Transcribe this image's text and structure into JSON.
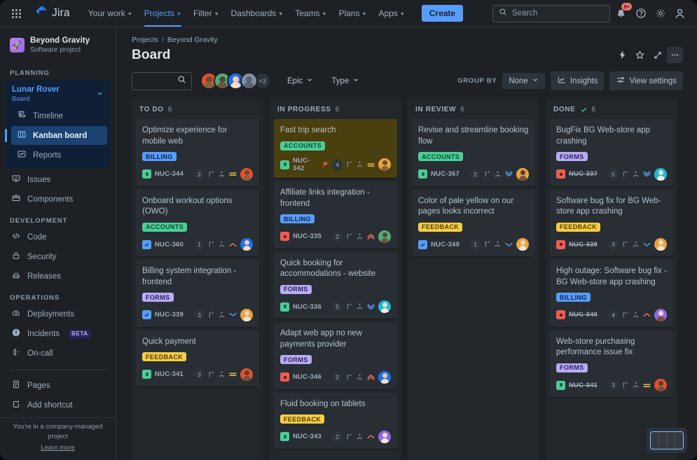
{
  "topnav": {
    "apps_icon": "apps-grid-icon",
    "brand": "Jira",
    "items": [
      {
        "label": "Your work",
        "has_caret": true,
        "active": false
      },
      {
        "label": "Projects",
        "has_caret": true,
        "active": true
      },
      {
        "label": "Filter",
        "has_caret": true,
        "active": false
      },
      {
        "label": "Dashboards",
        "has_caret": true,
        "active": false
      },
      {
        "label": "Teams",
        "has_caret": true,
        "active": false
      },
      {
        "label": "Plans",
        "has_caret": true,
        "active": false
      },
      {
        "label": "Apps",
        "has_caret": true,
        "active": false
      }
    ],
    "create_label": "Create",
    "search_placeholder": "Search",
    "notifications_badge": "9+",
    "icons": [
      "notification-bell-icon",
      "help-icon",
      "settings-gear-icon",
      "profile-avatar-icon"
    ],
    "accent": "#579dff"
  },
  "sidebar": {
    "project_name": "Beyond Gravity",
    "project_type": "Software project",
    "project_icon": "rocket-icon",
    "sections": [
      {
        "label": "PLANNING",
        "board_group": {
          "name": "Lunar Rover",
          "sub": "Board",
          "items": [
            {
              "label": "Timeline",
              "icon": "timeline-icon",
              "selected": false
            },
            {
              "label": "Kanban board",
              "icon": "board-columns-icon",
              "selected": true
            },
            {
              "label": "Reports",
              "icon": "reports-chart-icon",
              "selected": false
            }
          ]
        },
        "items": [
          {
            "label": "Issues",
            "icon": "issues-icon",
            "selected": false
          },
          {
            "label": "Components",
            "icon": "components-icon",
            "selected": false
          }
        ]
      },
      {
        "label": "DEVELOPMENT",
        "items": [
          {
            "label": "Code",
            "icon": "code-icon",
            "selected": false
          },
          {
            "label": "Security",
            "icon": "lock-icon",
            "selected": false
          },
          {
            "label": "Releases",
            "icon": "releases-ship-icon",
            "selected": false
          }
        ]
      },
      {
        "label": "OPERATIONS",
        "items": [
          {
            "label": "Deployments",
            "icon": "deployments-cloud-icon",
            "selected": false
          },
          {
            "label": "Incidents",
            "icon": "incident-alert-icon",
            "selected": false,
            "pill": "BETA"
          },
          {
            "label": "On-call",
            "icon": "on-call-phone-icon",
            "selected": false
          }
        ]
      },
      {
        "label": "",
        "items": [
          {
            "label": "Pages",
            "icon": "pages-document-icon",
            "selected": false
          },
          {
            "label": "Add shortcut",
            "icon": "add-shortcut-icon",
            "selected": false
          }
        ]
      }
    ],
    "footer_note": "You're in a company-managed project",
    "footer_link": "Learn more"
  },
  "main": {
    "breadcrumb": [
      "Projects",
      "Beyond Gravity"
    ],
    "breadcrumb_sep": "/",
    "title": "Board",
    "title_icons": [
      "lightning-automation-icon",
      "star-favorite-icon",
      "expand-fullscreen-icon",
      "more-actions-icon"
    ],
    "toolbar": {
      "search_placeholder": "",
      "search_icon": "search-icon",
      "avatars": [
        {
          "ring": "#e2502a",
          "head": "#6b4a33",
          "body": "#8a5f41"
        },
        {
          "ring": "#4bb07a",
          "head": "#5c4733",
          "body": "#6f573e"
        },
        {
          "ring": "#1e72e8",
          "head": "#f0cbae",
          "body": "#f6dcc6"
        },
        {
          "ring": "#8590a2",
          "head": "#b0b8c4",
          "body": "#b0b8c4"
        }
      ],
      "avatar_more": "+3",
      "epic_label": "Epic",
      "type_label": "Type",
      "group_by_label": "GROUP BY",
      "group_by_value": "None",
      "insights_label": "Insights",
      "insights_icon": "insights-chart-icon",
      "view_settings_label": "View settings",
      "view_settings_icon": "sliders-icon"
    },
    "minimap": {
      "segments": 4,
      "focus_color": "#85b8ff"
    }
  },
  "epic_colors": {
    "BILLING": {
      "bg": "#579dff",
      "fg": "#10243e"
    },
    "ACCOUNTS": {
      "bg": "#4bce97",
      "fg": "#164b35"
    },
    "FORMS": {
      "bg": "#b8acf6",
      "fg": "#2b2459"
    },
    "FEEDBACK": {
      "bg": "#f5cd47",
      "fg": "#533f04"
    }
  },
  "type_colors": {
    "story": {
      "bg": "#4bce97",
      "glyph": "bookmark"
    },
    "task": {
      "bg": "#579dff",
      "glyph": "check"
    },
    "bug": {
      "bg": "#f15b50",
      "glyph": "circle"
    }
  },
  "priority_colors": {
    "highest": "#f87168",
    "high": "#f87168",
    "medium": "#f5cd47",
    "low": "#579dff",
    "lowest": "#579dff"
  },
  "columns": [
    {
      "name": "TO DO",
      "count": "6",
      "done_check": false,
      "cards": [
        {
          "title": "Optimize experience for mobile web",
          "epic": "BILLING",
          "type": "story",
          "key": "NUC-344",
          "key_struck": false,
          "points": "2",
          "priority": "medium",
          "flagged": false,
          "highlight": false,
          "avatar": {
            "ring": "#e2502a",
            "head": "#6b4a33",
            "body": "#8a5f41"
          }
        },
        {
          "title": "Onboard workout options (OWO)",
          "epic": "ACCOUNTS",
          "type": "task",
          "key": "NUC-360",
          "key_struck": false,
          "points": "1",
          "priority": "high",
          "flagged": false,
          "highlight": false,
          "avatar": {
            "ring": "#1e72e8",
            "head": "#f0cbae",
            "body": "#f6dcc6"
          }
        },
        {
          "title": "Billing system integration - frontend",
          "epic": "FORMS",
          "type": "task",
          "key": "NUC-339",
          "key_struck": false,
          "points": "3",
          "priority": "low",
          "flagged": false,
          "highlight": false,
          "avatar": {
            "ring": "#e8a33d",
            "head": "#f0d6bd",
            "body": "#f6e4d2"
          }
        },
        {
          "title": "Quick payment",
          "epic": "FEEDBACK",
          "type": "story",
          "key": "NUC-341",
          "key_struck": false,
          "points": "3",
          "priority": "medium",
          "flagged": false,
          "highlight": false,
          "avatar": {
            "ring": "#e2502a",
            "head": "#5a4030",
            "body": "#74523c"
          }
        }
      ]
    },
    {
      "name": "IN PROGRESS",
      "count": "6",
      "done_check": false,
      "cards": [
        {
          "title": "Fast trip search",
          "epic": "ACCOUNTS",
          "type": "story",
          "key": "NUC-342",
          "key_struck": false,
          "points": "4",
          "priority": "medium",
          "flagged": true,
          "highlight": true,
          "avatar": {
            "ring": "#e8a33d",
            "head": "#6b4a33",
            "body": "#8a5f41"
          }
        },
        {
          "title": "Affiliate links integration - frontend",
          "epic": "BILLING",
          "type": "bug",
          "key": "NUC-335",
          "key_struck": false,
          "points": "2",
          "priority": "highest",
          "flagged": false,
          "highlight": false,
          "avatar": {
            "ring": "#4bb07a",
            "head": "#5c4733",
            "body": "#6f573e"
          }
        },
        {
          "title": "Quick booking for accommodations - website",
          "epic": "FORMS",
          "type": "story",
          "key": "NUC-336",
          "key_struck": false,
          "points": "5",
          "priority": "lowest",
          "flagged": false,
          "highlight": false,
          "avatar": {
            "ring": "#1fb8d1",
            "head": "#eddfd3",
            "body": "#f4ece3"
          }
        },
        {
          "title": "Adapt web app no new payments provider",
          "epic": "FORMS",
          "type": "bug",
          "key": "NUC-346",
          "key_struck": false,
          "points": "2",
          "priority": "highest",
          "flagged": false,
          "highlight": false,
          "avatar": {
            "ring": "#1e72e8",
            "head": "#f0cbae",
            "body": "#f6dcc6"
          }
        },
        {
          "title": "Fluid booking on tablets",
          "epic": "FEEDBACK",
          "type": "story",
          "key": "NUC-343",
          "key_struck": false,
          "points": "2",
          "priority": "high",
          "flagged": false,
          "highlight": false,
          "avatar": {
            "ring": "#8f6ae0",
            "head": "#f0dcc8",
            "body": "#f6e8da"
          }
        }
      ]
    },
    {
      "name": "IN REVIEW",
      "count": "6",
      "done_check": false,
      "cards": [
        {
          "title": "Revise and streamline booking flow",
          "epic": "ACCOUNTS",
          "type": "story",
          "key": "NUC-367",
          "key_struck": false,
          "points": "2",
          "priority": "lowest",
          "flagged": false,
          "highlight": false,
          "avatar": {
            "ring": "#e8a33d",
            "head": "#5a4030",
            "body": "#74523c"
          }
        },
        {
          "title": "Color of pale yellow on our pages looks incorrect",
          "epic": "FEEDBACK",
          "type": "task",
          "key": "NUC-349",
          "key_struck": false,
          "points": "1",
          "priority": "low",
          "flagged": false,
          "highlight": false,
          "avatar": {
            "ring": "#e8a33d",
            "head": "#f0d6bd",
            "body": "#f6e4d2"
          }
        }
      ]
    },
    {
      "name": "DONE",
      "count": "6",
      "done_check": true,
      "cards": [
        {
          "title": "BugFix BG Web-store app crashing",
          "epic": "FORMS",
          "type": "bug",
          "key": "NUC-337",
          "key_struck": true,
          "points": "5",
          "priority": "lowest",
          "flagged": false,
          "highlight": false,
          "avatar": {
            "ring": "#1fb8d1",
            "head": "#eddfd3",
            "body": "#f4ece3"
          }
        },
        {
          "title": "Software bug fix for BG Web-store app crashing",
          "epic": "FEEDBACK",
          "type": "bug",
          "key": "NUC-339",
          "key_struck": true,
          "points": "3",
          "priority": "low",
          "flagged": false,
          "highlight": false,
          "avatar": {
            "ring": "#e8a33d",
            "head": "#f0d6bd",
            "body": "#f6e4d2"
          }
        },
        {
          "title": "High outage: Software bug fix - BG Web-store app crashing",
          "epic": "BILLING",
          "type": "bug",
          "key": "NUC-340",
          "key_struck": true,
          "points": "4",
          "priority": "high",
          "flagged": false,
          "highlight": false,
          "avatar": {
            "ring": "#8f6ae0",
            "head": "#f0dcc8",
            "body": "#7a4a3c"
          }
        },
        {
          "title": "Web-store purchasing performance issue fix",
          "epic": "FORMS",
          "type": "story",
          "key": "NUC-341",
          "key_struck": true,
          "points": "3",
          "priority": "medium",
          "flagged": false,
          "highlight": false,
          "avatar": {
            "ring": "#e2502a",
            "head": "#5a4030",
            "body": "#74523c"
          }
        }
      ]
    }
  ]
}
